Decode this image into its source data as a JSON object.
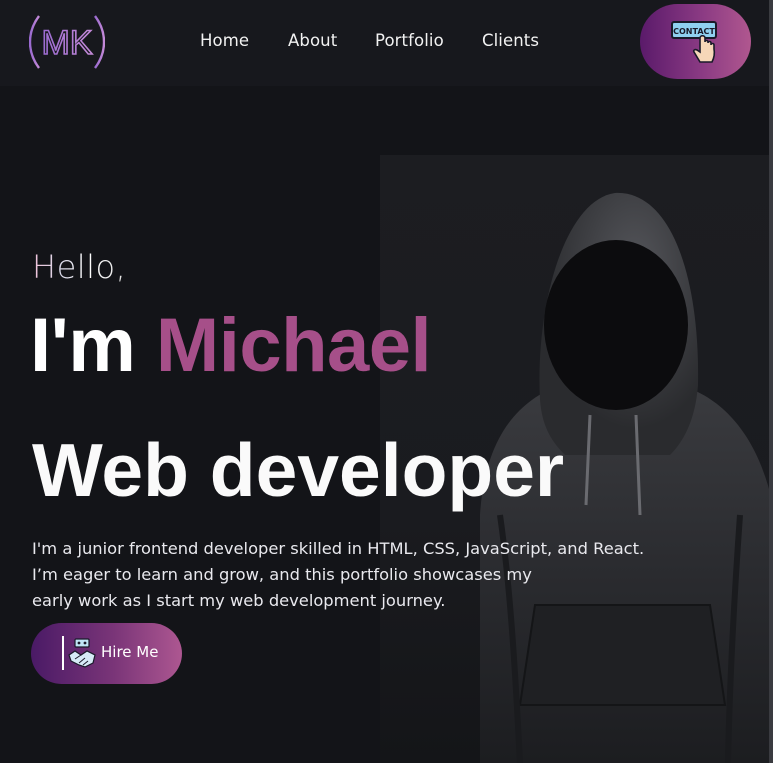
{
  "header": {
    "logo_text": "MK",
    "nav": [
      {
        "label": "Home"
      },
      {
        "label": "About"
      },
      {
        "label": "Portfolio"
      },
      {
        "label": "Clients"
      }
    ],
    "contact_button": {
      "icon_text": "CONTACT",
      "icon": "hand-pointer-icon"
    }
  },
  "hero": {
    "greeting": "Hello,",
    "name_prefix": "I'm ",
    "name": "Michael",
    "role": "Web developer",
    "description": [
      "I'm a junior frontend developer skilled in HTML, CSS, JavaScript, and React.",
      "I’m eager to learn and grow, and this portfolio showcases my",
      "early work as I start my web development journey."
    ],
    "hire_button": {
      "label": "Hire Me",
      "icon": "handshake-icon"
    },
    "image": "hooded-figure"
  },
  "colors": {
    "background": "#131418",
    "header_bg": "#17181d",
    "accent": "#a64f89",
    "gradient_start": "#5a1a6a",
    "gradient_end": "#b0578f"
  }
}
